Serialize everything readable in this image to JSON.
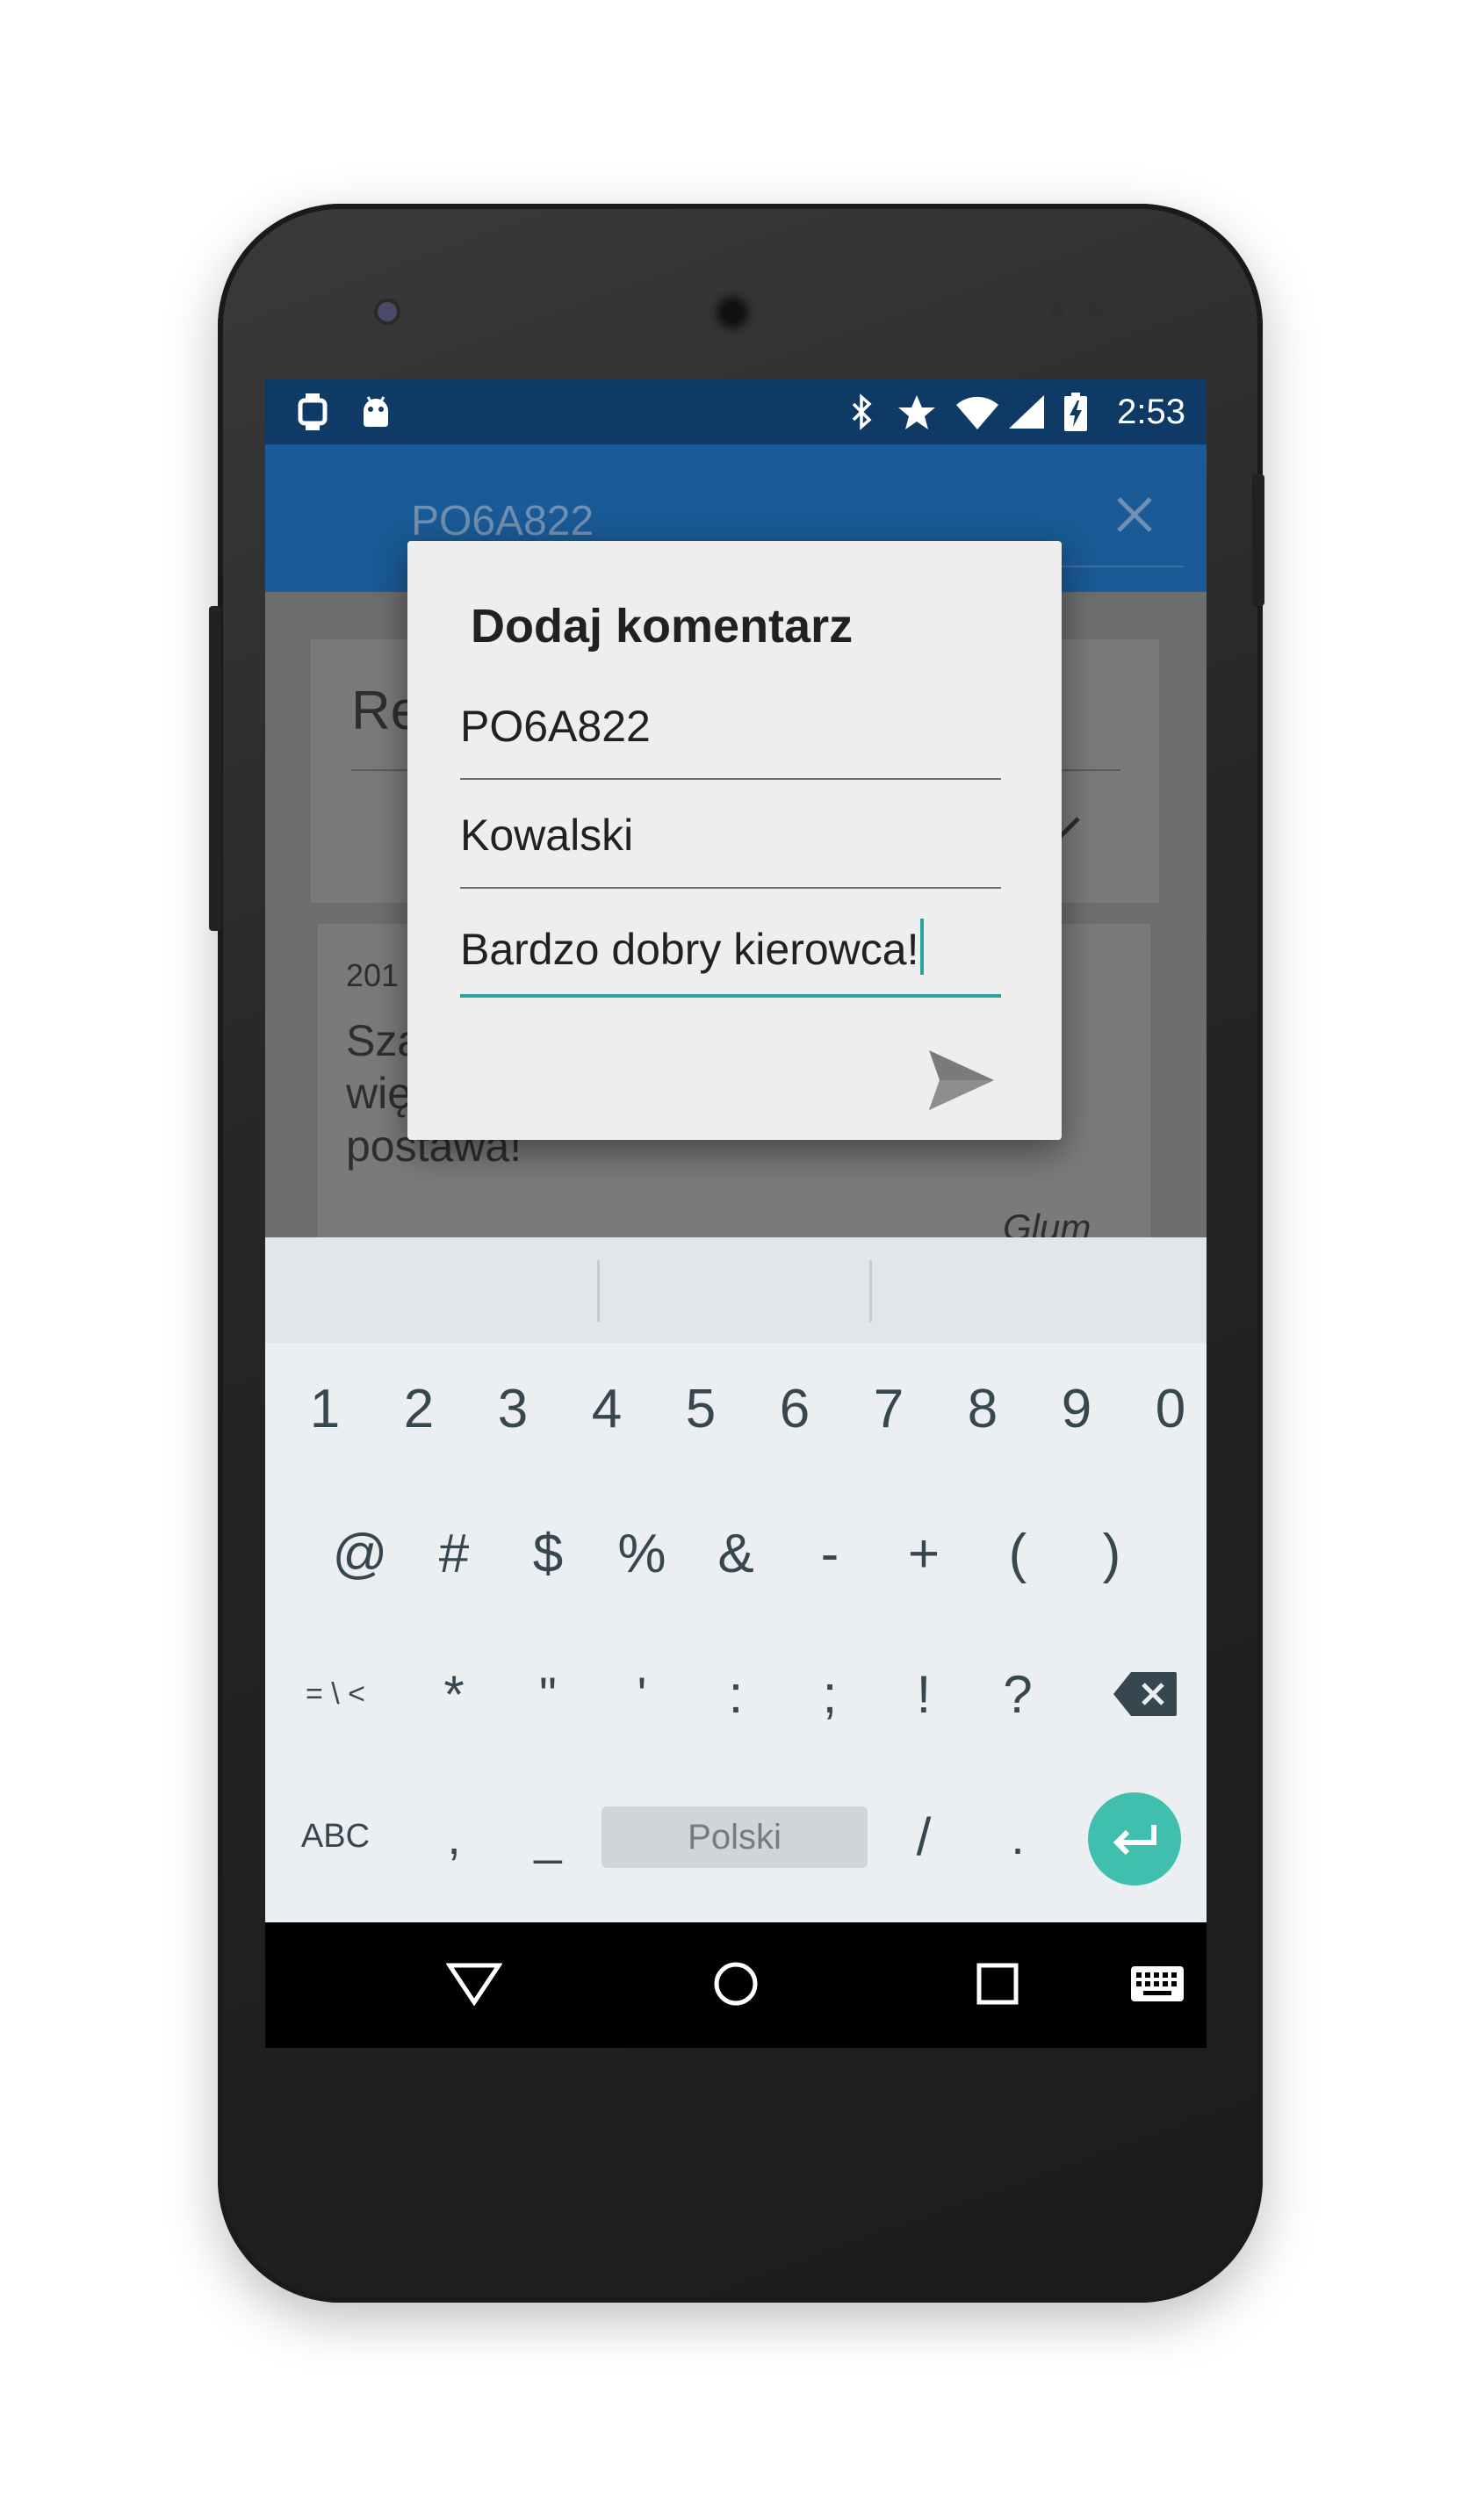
{
  "status_bar": {
    "time": "2:53",
    "icons": [
      "watch-icon",
      "android-icon",
      "bluetooth-icon",
      "star-icon",
      "wifi-icon",
      "signal-icon",
      "battery-charging-icon"
    ]
  },
  "app_bar": {
    "title": "PO6A822",
    "close_icon": "close-icon"
  },
  "background": {
    "card_title_partial": "Re",
    "comment_date_partial": "201",
    "comment_line1_partial": "Sza",
    "comment_line2_partial": "wię",
    "comment_line3": "postawa!",
    "comment_author_partial": "Glum"
  },
  "dialog": {
    "title": "Dodaj komentarz",
    "fields": [
      {
        "value": "PO6A822"
      },
      {
        "value": "Kowalski"
      },
      {
        "value": "Bardzo dobry kierowca!"
      }
    ],
    "send_icon": "send-icon"
  },
  "keyboard": {
    "row1": [
      "1",
      "2",
      "3",
      "4",
      "5",
      "6",
      "7",
      "8",
      "9",
      "0"
    ],
    "row2": [
      "@",
      "#",
      "$",
      "%",
      "&",
      "-",
      "+",
      "(",
      ")"
    ],
    "row3": [
      "= \\ <",
      "*",
      "\"",
      "'",
      ":",
      ";",
      "!",
      "?"
    ],
    "row4": {
      "abc": "ABC",
      "comma": ",",
      "underscore": "_",
      "space": "Polski",
      "slash": "/",
      "period": "."
    },
    "backspace_icon": "backspace-icon",
    "enter_icon": "enter-icon"
  },
  "nav_bar": {
    "icons": [
      "back-icon",
      "home-icon",
      "recents-icon",
      "keyboard-switch-icon"
    ]
  },
  "colors": {
    "status_bar": "#0f3a66",
    "app_bar": "#1a5a96",
    "accent": "#27a59a",
    "enter_key": "#40bfae",
    "dialog_bg": "#eeeeee",
    "keyboard_bg": "#eceff1"
  }
}
